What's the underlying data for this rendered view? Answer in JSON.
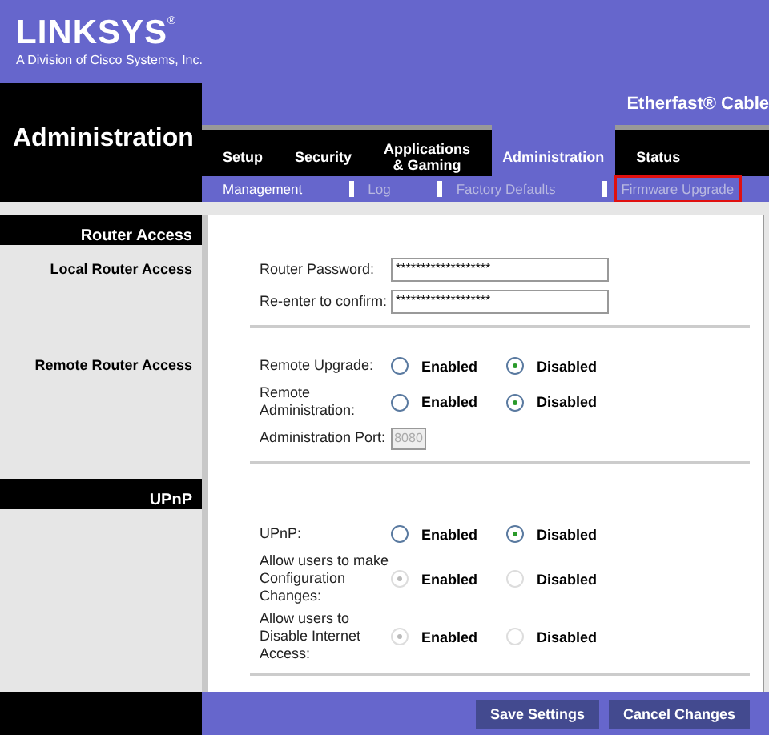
{
  "header": {
    "logo": "LINKSYS",
    "logo_mark": "®",
    "tagline": "A Division of Cisco Systems, Inc.",
    "product": "Etherfast® Cable"
  },
  "page_title": "Administration",
  "tabs": [
    {
      "label": "Setup",
      "selected": false
    },
    {
      "label": "Security",
      "selected": false
    },
    {
      "label": "Applications\n& Gaming",
      "selected": false
    },
    {
      "label": "Administration",
      "selected": true
    },
    {
      "label": "Status",
      "selected": false
    }
  ],
  "subtabs": [
    {
      "label": "Management",
      "selected": true,
      "highlighted": false
    },
    {
      "label": "Log",
      "selected": false,
      "highlighted": false
    },
    {
      "label": "Factory Defaults",
      "selected": false,
      "highlighted": false
    },
    {
      "label": "Firmware Upgrade",
      "selected": false,
      "highlighted": true
    }
  ],
  "sections": [
    {
      "title": "Router Access",
      "groups": [
        {
          "label": "Local Router Access",
          "rows": [
            {
              "kind": "password",
              "label": "Router Password:",
              "value": "*******************"
            },
            {
              "kind": "password",
              "label": "Re-enter to confirm:",
              "value": "*******************"
            }
          ]
        },
        {
          "label": "Remote Router Access",
          "rows": [
            {
              "kind": "radio",
              "label": "Remote Upgrade:",
              "disabled": false,
              "options": [
                {
                  "label": "Enabled",
                  "selected": false
                },
                {
                  "label": "Disabled",
                  "selected": true
                }
              ]
            },
            {
              "kind": "radio",
              "label": "Remote Administration:",
              "disabled": false,
              "options": [
                {
                  "label": "Enabled",
                  "selected": false
                },
                {
                  "label": "Disabled",
                  "selected": true
                }
              ]
            },
            {
              "kind": "port",
              "label": "Administration Port:",
              "value": "8080",
              "disabled": true
            }
          ]
        }
      ]
    },
    {
      "title": "UPnP",
      "groups": [
        {
          "rows": [
            {
              "kind": "radio",
              "label": "UPnP:",
              "disabled": false,
              "options": [
                {
                  "label": "Enabled",
                  "selected": false
                },
                {
                  "label": "Disabled",
                  "selected": true
                }
              ]
            },
            {
              "kind": "radio",
              "label": "Allow users to make Configuration Changes:",
              "disabled": true,
              "options": [
                {
                  "label": "Enabled",
                  "selected": true
                },
                {
                  "label": "Disabled",
                  "selected": false
                }
              ]
            },
            {
              "kind": "radio",
              "label": "Allow users to Disable Internet Access:",
              "disabled": true,
              "options": [
                {
                  "label": "Enabled",
                  "selected": true
                },
                {
                  "label": "Disabled",
                  "selected": false
                }
              ]
            }
          ]
        }
      ]
    }
  ],
  "buttons": [
    "Save Settings",
    "Cancel Changes"
  ]
}
